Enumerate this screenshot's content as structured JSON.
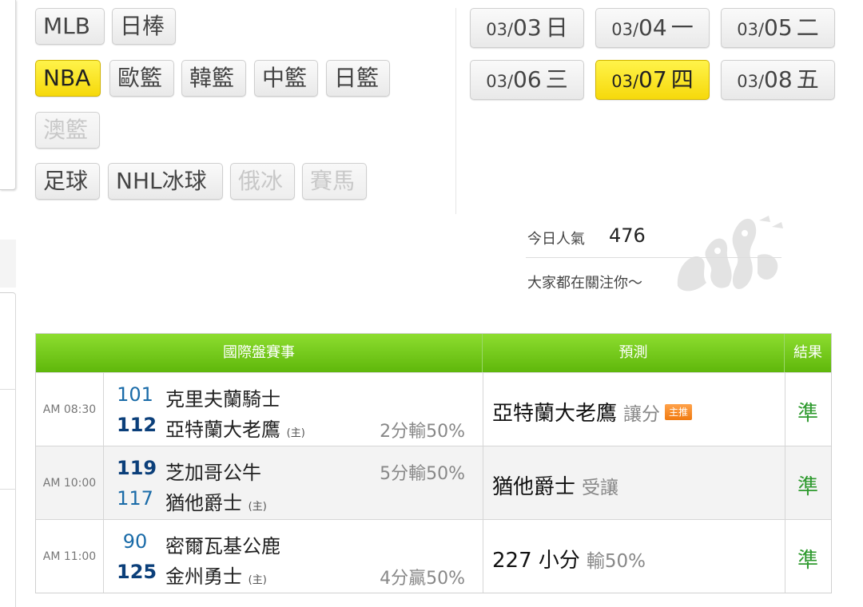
{
  "sports": [
    {
      "label": "MLB",
      "state": "normal"
    },
    {
      "label": "日棒",
      "state": "normal"
    },
    {
      "label": "NBA",
      "state": "active"
    },
    {
      "label": "歐籃",
      "state": "normal"
    },
    {
      "label": "韓籃",
      "state": "normal"
    },
    {
      "label": "中籃",
      "state": "normal"
    },
    {
      "label": "日籃",
      "state": "normal"
    },
    {
      "label": "澳籃",
      "state": "disabled"
    },
    {
      "label": "足球",
      "state": "normal"
    },
    {
      "label": "NHL冰球",
      "state": "normal"
    },
    {
      "label": "俄冰",
      "state": "disabled"
    },
    {
      "label": "賽馬",
      "state": "disabled"
    }
  ],
  "dates": [
    {
      "month": "03/",
      "day": "03",
      "weekday": "日",
      "active": false
    },
    {
      "month": "03/",
      "day": "04",
      "weekday": "一",
      "active": false
    },
    {
      "month": "03/",
      "day": "05",
      "weekday": "二",
      "active": false
    },
    {
      "month": "03/",
      "day": "06",
      "weekday": "三",
      "active": false
    },
    {
      "month": "03/",
      "day": "07",
      "weekday": "四",
      "active": true
    },
    {
      "month": "03/",
      "day": "08",
      "weekday": "五",
      "active": false
    }
  ],
  "popularity": {
    "label": "今日人氣",
    "value": "476",
    "subtitle": "大家都在關注你～"
  },
  "table": {
    "headers": {
      "event": "國際盤賽事",
      "prediction": "預測",
      "result": "結果"
    },
    "rows": [
      {
        "time": "AM 08:30",
        "away_score": "101",
        "away_team": "克里夫蘭騎士",
        "home_score": "112",
        "home_team": "亞特蘭大老鷹",
        "home_tag": "(主)",
        "odds": "2分輸50%",
        "prediction": "亞特蘭大老鷹",
        "prediction_type": "讓分",
        "badge": "主推",
        "result": "準"
      },
      {
        "time": "AM 10:00",
        "away_score": "119",
        "away_team": "芝加哥公牛",
        "home_score": "117",
        "home_team": "猶他爵士",
        "home_tag": "(主)",
        "odds": "5分輸50%",
        "prediction": "猶他爵士",
        "prediction_type": "受讓",
        "badge": "",
        "result": "準"
      },
      {
        "time": "AM 11:00",
        "away_score": "90",
        "away_team": "密爾瓦基公鹿",
        "home_score": "125",
        "home_team": "金州勇士",
        "home_tag": "(主)",
        "odds": "4分贏50%",
        "prediction": "227 小分",
        "prediction_type": "輸50%",
        "badge": "",
        "result": "準"
      }
    ]
  },
  "colors": {
    "active_yellow": "#f6d90b",
    "header_green": "#5fb70b",
    "score_blue": "#1a6ba8",
    "result_green": "#2e9a2e",
    "badge_orange": "#f07a10"
  }
}
